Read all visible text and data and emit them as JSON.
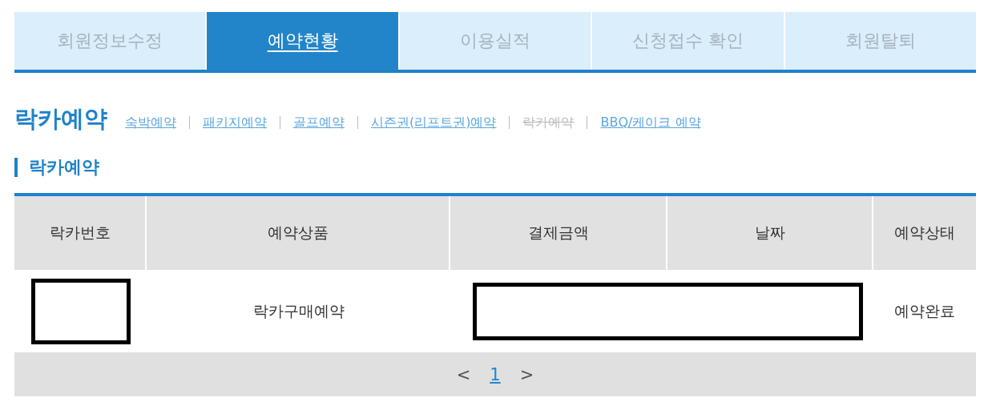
{
  "tabs": [
    {
      "label": "회원정보수정",
      "selected": false
    },
    {
      "label": "예약현황",
      "selected": true
    },
    {
      "label": "이용실적",
      "selected": false
    },
    {
      "label": "신청접수 확인",
      "selected": false
    },
    {
      "label": "회원탈퇴",
      "selected": false
    }
  ],
  "page_title": "락카예약",
  "sub_links": [
    {
      "label": "숙박예약",
      "selected": false
    },
    {
      "label": "패키지예약",
      "selected": false
    },
    {
      "label": "골프예약",
      "selected": false
    },
    {
      "label": "시즌권(리프트권)예약",
      "selected": false
    },
    {
      "label": "락카예약",
      "selected": true
    },
    {
      "label": "BBQ/케이크 예약",
      "selected": false
    }
  ],
  "section_title": "락카예약",
  "table": {
    "columns": [
      "락카번호",
      "예약상품",
      "결제금액",
      "날짜",
      "예약상태"
    ],
    "rows": [
      {
        "cells": [
          {
            "kind": "redacted"
          },
          {
            "kind": "text",
            "text": "락카구매예약"
          },
          {
            "kind": "redacted-wide"
          },
          {
            "kind": "covered"
          },
          {
            "kind": "text",
            "text": "예약완료"
          }
        ]
      }
    ]
  },
  "pagination": {
    "prev": "<",
    "pages": [
      {
        "label": "1",
        "selected": true
      }
    ],
    "next": ">"
  }
}
